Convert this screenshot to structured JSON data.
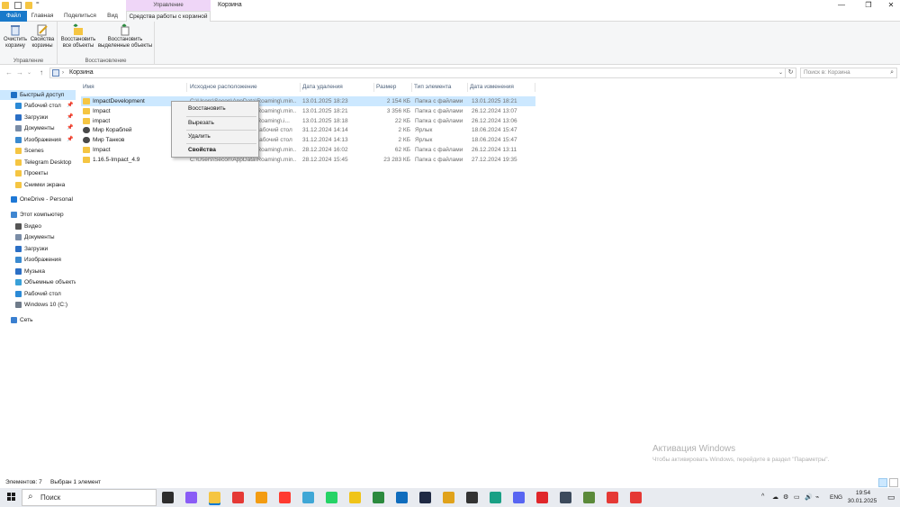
{
  "titlebar": {
    "manage_tab_header": "Управление",
    "window_title": "Корзина",
    "qa_dropdown": "=",
    "btn_min": "—",
    "btn_max": "❐",
    "btn_close": "✕"
  },
  "ribbon_tabs": {
    "file": "Файл",
    "home": "Главная",
    "share": "Поделиться",
    "view": "Вид",
    "manage": "Средства работы с корзиной"
  },
  "ribbon": {
    "groups": [
      {
        "label": "Управление",
        "buttons": [
          {
            "label1": "Очистить",
            "label2": "корзину"
          },
          {
            "label1": "Свойства",
            "label2": "корзины"
          }
        ]
      },
      {
        "label": "Восстановление",
        "buttons": [
          {
            "label1": "Восстановить",
            "label2": "все объекты"
          },
          {
            "label1": "Восстановить",
            "label2": "выделенные объекты"
          }
        ]
      }
    ]
  },
  "addressbar": {
    "back": "←",
    "forward": "→",
    "recent": "⌄",
    "up": "↑",
    "separator": "›",
    "path": "Корзина",
    "dropdown": "⌄",
    "refresh": "↻",
    "search_placeholder": "Поиск в: Корзина",
    "search_icon": "⌕"
  },
  "sidebar": {
    "items": [
      {
        "label": "Быстрый доступ",
        "icon": "star-icon",
        "color": "#1e6fc5",
        "pinned": false
      },
      {
        "label": "Рабочий стол",
        "icon": "desktop-icon",
        "color": "#2b8ad6",
        "pinned": true
      },
      {
        "label": "Загрузки",
        "icon": "download-icon",
        "color": "#2b6fc5",
        "pinned": true
      },
      {
        "label": "Документы",
        "icon": "documents-icon",
        "color": "#7a8ca6",
        "pinned": true
      },
      {
        "label": "Изображения",
        "icon": "pictures-icon",
        "color": "#3a8ad0",
        "pinned": true
      },
      {
        "label": "Scenes",
        "icon": "folder-icon",
        "color": "#f5c542",
        "pinned": false
      },
      {
        "label": "Telegram Desktop",
        "icon": "folder-icon",
        "color": "#f5c542",
        "pinned": false
      },
      {
        "label": "Проекты",
        "icon": "folder-icon",
        "color": "#f5c542",
        "pinned": false
      },
      {
        "label": "Снимки экрана",
        "icon": "folder-icon",
        "color": "#f5c542",
        "pinned": false
      },
      {
        "label": "OneDrive - Personal",
        "icon": "onedrive-icon",
        "color": "#1e78d6",
        "pinned": false
      },
      {
        "label": "Этот компьютер",
        "icon": "computer-icon",
        "color": "#3f86d1",
        "pinned": false
      },
      {
        "label": "Видео",
        "icon": "video-icon",
        "color": "#555555",
        "pinned": false
      },
      {
        "label": "Документы",
        "icon": "documents-icon",
        "color": "#7a8ca6",
        "pinned": false
      },
      {
        "label": "Загрузки",
        "icon": "download-icon",
        "color": "#2b6fc5",
        "pinned": false
      },
      {
        "label": "Изображения",
        "icon": "pictures-icon",
        "color": "#3a8ad0",
        "pinned": false
      },
      {
        "label": "Музыка",
        "icon": "music-icon",
        "color": "#2b6fc5",
        "pinned": false
      },
      {
        "label": "Объемные объекты",
        "icon": "3d-objects-icon",
        "color": "#39a0d8",
        "pinned": false
      },
      {
        "label": "Рабочий стол",
        "icon": "desktop-icon",
        "color": "#2b8ad6",
        "pinned": false
      },
      {
        "label": "Windows 10 (C:)",
        "icon": "drive-icon",
        "color": "#6f7b8a",
        "pinned": false
      },
      {
        "label": "Сеть",
        "icon": "network-icon",
        "color": "#3a7fd0",
        "pinned": false
      }
    ],
    "pin_glyph": "📌"
  },
  "columns": {
    "name": "Имя",
    "original_location": "Исходное расположение",
    "date_deleted": "Дата удаления",
    "size": "Размер",
    "item_type": "Тип элемента",
    "date_modified": "Дата изменения"
  },
  "files": [
    {
      "name": "ImpactDevelopment",
      "orig": "C:\\Users\\Secon\\AppData\\Roaming\\.min...",
      "date": "13.01.2025 18:23",
      "size": "2 154 КБ",
      "type": "Папка с файлами",
      "mod": "13.01.2025 18:21",
      "icon": "folder-icon",
      "selected": true
    },
    {
      "name": "Impact",
      "orig": "C:\\Users\\Secon\\AppData\\Roaming\\.min...",
      "date": "13.01.2025 18:21",
      "size": "3 356 КБ",
      "type": "Папка с файлами",
      "mod": "26.12.2024 13:07",
      "icon": "folder-icon",
      "selected": false
    },
    {
      "name": "impact",
      "orig": "C:\\Users\\Secon\\AppData\\Roaming\\.i...",
      "date": "13.01.2025 18:18",
      "size": "22 КБ",
      "type": "Папка с файлами",
      "mod": "26.12.2024 13:06",
      "icon": "folder-icon",
      "selected": false
    },
    {
      "name": "Мир Кораблей",
      "orig": "C:\\Users\\Secon\\Desktop\\Рабочий стол",
      "date": "31.12.2024 14:14",
      "size": "2 КБ",
      "type": "Ярлык",
      "mod": "18.06.2024 15:47",
      "icon": "shortcut-icon",
      "selected": false
    },
    {
      "name": "Мир Танков",
      "orig": "C:\\Users\\Secon\\Desktop\\Рабочий стол",
      "date": "31.12.2024 14:13",
      "size": "2 КБ",
      "type": "Ярлык",
      "mod": "18.06.2024 15:47",
      "icon": "shortcut-icon",
      "selected": false
    },
    {
      "name": "Impact",
      "orig": "C:\\Users\\Secon\\AppData\\Roaming\\.min...",
      "date": "28.12.2024 16:02",
      "size": "62 КБ",
      "type": "Папка с файлами",
      "mod": "26.12.2024 13:11",
      "icon": "folder-icon",
      "selected": false
    },
    {
      "name": "1.16.5-Impact_4.9",
      "orig": "C:\\Users\\Secon\\AppData\\Roaming\\.min...",
      "date": "28.12.2024 15:45",
      "size": "23 283 КБ",
      "type": "Папка с файлами",
      "mod": "27.12.2024 19:35",
      "icon": "folder-icon",
      "selected": false
    }
  ],
  "context_menu": {
    "restore": "Восстановить",
    "cut": "Вырезать",
    "delete": "Удалить",
    "properties": "Свойства"
  },
  "watermark": {
    "title": "Активация Windows",
    "subtitle": "Чтобы активировать Windows, перейдите в раздел \"Параметры\"."
  },
  "statusbar": {
    "count": "Элементов: 7",
    "selected": "Выбран 1 элемент"
  },
  "taskbar": {
    "search_icon": "⌕",
    "search_text": "Поиск",
    "apps": [
      {
        "name": "task-view-icon",
        "color": "#2d2d2d"
      },
      {
        "name": "copilot-icon",
        "color": "#8a5cf6"
      },
      {
        "name": "file-explorer-icon",
        "color": "#f5c542"
      },
      {
        "name": "yandex-browser-icon",
        "color": "#e53935"
      },
      {
        "name": "store-icon",
        "color": "#f39c12"
      },
      {
        "name": "yandex-icon",
        "color": "#ff3b30"
      },
      {
        "name": "photos-icon",
        "color": "#3fa7d6"
      },
      {
        "name": "whatsapp-icon",
        "color": "#25d366"
      },
      {
        "name": "app-icon",
        "color": "#f0c419"
      },
      {
        "name": "mail-app-icon",
        "color": "#2b8a3e"
      },
      {
        "name": "outlook-icon",
        "color": "#0f6cbd"
      },
      {
        "name": "app-dark-icon",
        "color": "#1f2a44"
      },
      {
        "name": "folder-app-icon",
        "color": "#e0a21b"
      },
      {
        "name": "game-icon",
        "color": "#333333"
      },
      {
        "name": "edge-icon",
        "color": "#1aa085"
      },
      {
        "name": "discord-icon",
        "color": "#5865f2"
      },
      {
        "name": "opera-icon",
        "color": "#e0262a"
      },
      {
        "name": "calculator-icon",
        "color": "#3c4a5c"
      },
      {
        "name": "minecraft-icon",
        "color": "#5b8a3a"
      },
      {
        "name": "video-app-icon",
        "color": "#e53935"
      },
      {
        "name": "video-app-2-icon",
        "color": "#e53935"
      }
    ],
    "tray": {
      "chevron": "^",
      "icons": [
        "☁",
        "⚙",
        "▭",
        "🔊",
        "⌁"
      ],
      "lang": "ENG",
      "time": "19:54",
      "date": "30.01.2025",
      "notification_icon": "▭"
    }
  }
}
